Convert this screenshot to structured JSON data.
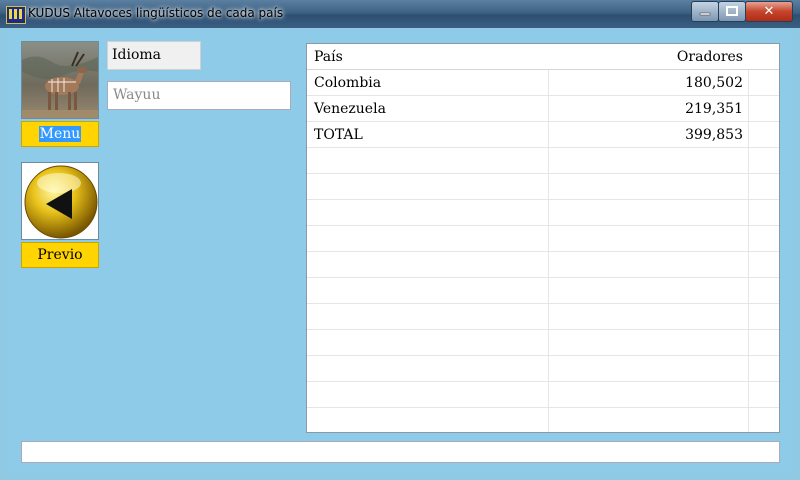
{
  "window": {
    "title": "KUDUS Altavoces lingüísticos de cada país",
    "close_glyph": "✕"
  },
  "sidebar": {
    "menu_label": "Menu",
    "previo_label": "Previo"
  },
  "form": {
    "idioma_label": "Idioma",
    "language_value": "Wayuu"
  },
  "table": {
    "headers": {
      "country": "País",
      "speakers": "Oradores"
    },
    "rows": [
      {
        "country": "Colombia",
        "speakers": "180,502"
      },
      {
        "country": "Venezuela",
        "speakers": "219,351"
      },
      {
        "country": "TOTAL",
        "speakers": "399,853"
      }
    ]
  },
  "status": {
    "text": ""
  }
}
